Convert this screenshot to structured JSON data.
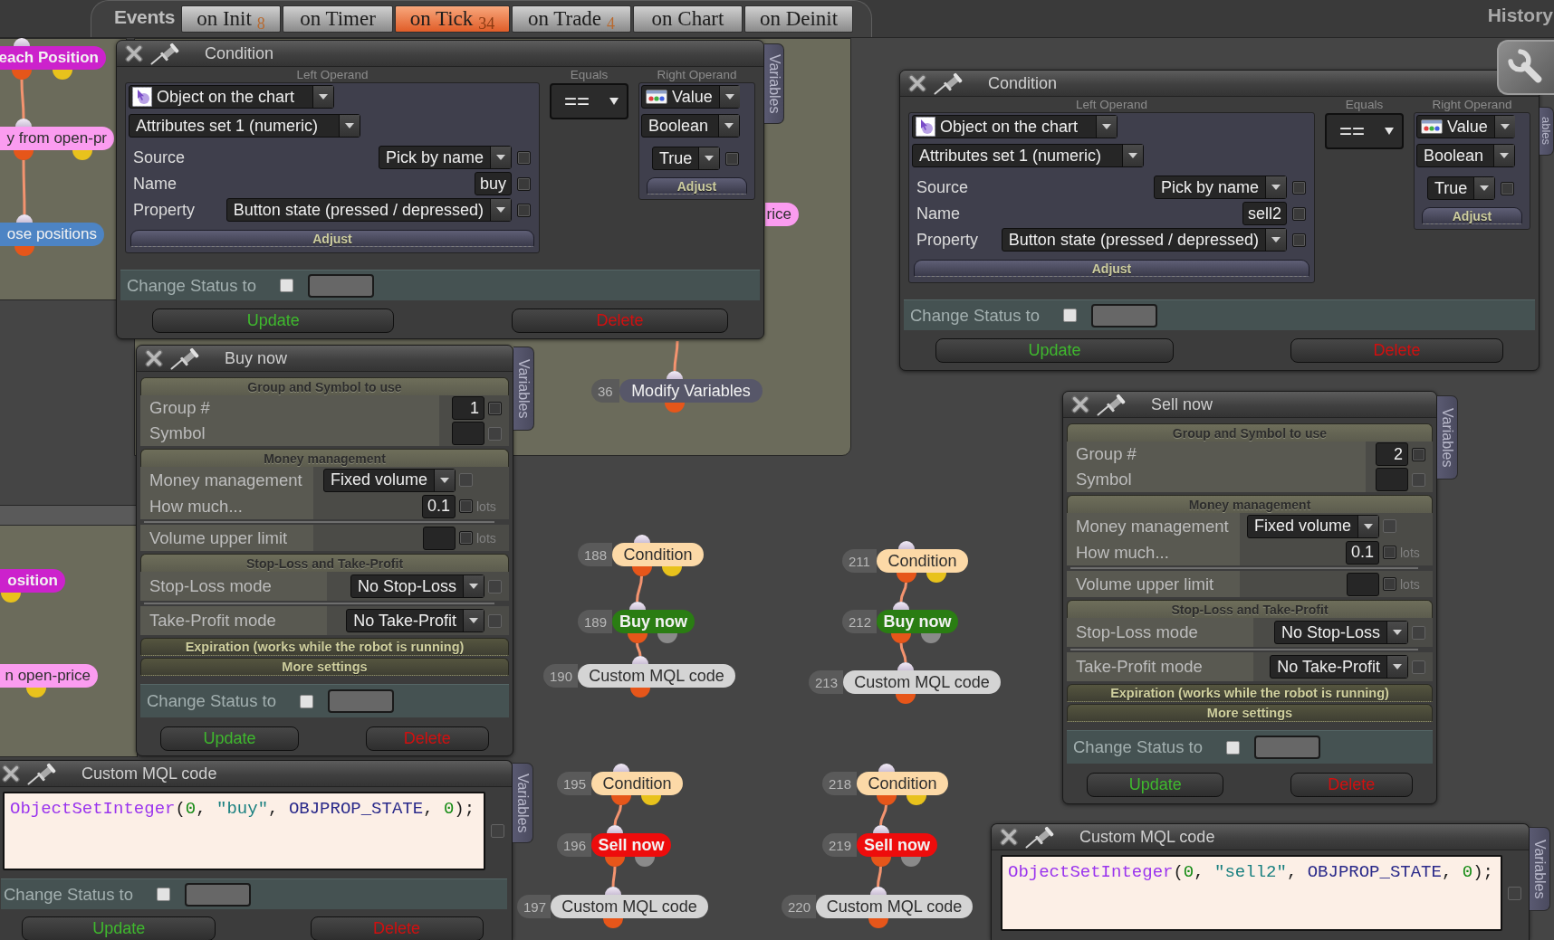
{
  "toolbar": {
    "label": "Events",
    "tabs": [
      {
        "label": "on Init",
        "count": "8",
        "selected": false
      },
      {
        "label": "on Timer",
        "selected": false
      },
      {
        "label": "on Tick",
        "count": "34",
        "selected": true
      },
      {
        "label": "on Trade",
        "count": "4",
        "selected": false
      },
      {
        "label": "on Chart",
        "selected": false
      },
      {
        "label": "on Deinit",
        "selected": false
      }
    ],
    "history": "History"
  },
  "nodes": [
    {
      "label": "each Position",
      "kind": "loop",
      "color": "#cc22cc",
      "connected": false
    },
    {
      "label": "y from open-pr",
      "kind": "filter",
      "color": "#fb9cf0",
      "connected": true
    },
    {
      "label": "ose positions",
      "kind": "close",
      "color": "#4d84c4",
      "connected": true
    },
    {
      "label": "osition",
      "kind": "loop",
      "color": "#cc22cc",
      "connected": false
    },
    {
      "label": "n open-price",
      "kind": "filter",
      "color": "#fb9cf0",
      "connected": false
    },
    {
      "label": "rice",
      "kind": "filter",
      "color": "#fb9cf0",
      "connected": false
    },
    {
      "number": "36",
      "label": "Modify Variables",
      "kind": "variables",
      "color": "#575769",
      "connected": true
    },
    {
      "number": "188",
      "label": "Condition",
      "kind": "condition",
      "color": "#fcd9a7",
      "connected": false
    },
    {
      "number": "189",
      "label": "Buy now",
      "kind": "trade",
      "color": "#2a7d13",
      "connected": true
    },
    {
      "number": "190",
      "label": "Custom MQL code",
      "kind": "code",
      "color": "#d4d4d4",
      "connected": true
    },
    {
      "number": "211",
      "label": "Condition",
      "kind": "condition",
      "color": "#fcd9a7",
      "connected": false
    },
    {
      "number": "212",
      "label": "Buy now",
      "kind": "trade",
      "color": "#2a7d13",
      "connected": true
    },
    {
      "number": "213",
      "label": "Custom MQL code",
      "kind": "code",
      "color": "#d4d4d4",
      "connected": true
    },
    {
      "number": "195",
      "label": "Condition",
      "kind": "condition",
      "color": "#fcd9a7",
      "connected": false
    },
    {
      "number": "196",
      "label": "Sell now",
      "kind": "trade",
      "color": "#ee0c0c",
      "connected": true
    },
    {
      "number": "197",
      "label": "Custom MQL code",
      "kind": "code",
      "color": "#d4d4d4",
      "connected": true
    },
    {
      "number": "218",
      "label": "Condition",
      "kind": "condition",
      "color": "#fcd9a7",
      "connected": false
    },
    {
      "number": "219",
      "label": "Sell now",
      "kind": "trade",
      "color": "#ee0c0c",
      "connected": true
    },
    {
      "number": "220",
      "label": "Custom MQL code",
      "kind": "code",
      "color": "#d4d4d4",
      "connected": true
    }
  ],
  "condition_panels": [
    {
      "title": "Condition",
      "side_tab": "Variables",
      "left_operand": {
        "heading": "Left Operand",
        "type": "Object on the chart",
        "attributes": "Attributes set 1 (numeric)",
        "fields": [
          {
            "label": "Source",
            "kind": "dropdown",
            "value": "Pick by name",
            "checked": false
          },
          {
            "label": "Name",
            "kind": "input",
            "value": "buy",
            "checked": false
          },
          {
            "label": "Property",
            "kind": "dropdown",
            "value": "Button state (pressed / depressed)",
            "checked": false
          }
        ],
        "adjust": "Adjust"
      },
      "operator": {
        "heading": "Equals",
        "value": "=="
      },
      "right_operand": {
        "heading": "Right Operand",
        "type": "Value",
        "data_type": "Boolean",
        "value": "True",
        "checked": false,
        "adjust": "Adjust"
      },
      "status": {
        "label": "Change Status to",
        "checked": false
      },
      "buttons": {
        "update": "Update",
        "delete": "Delete"
      }
    },
    {
      "title": "Condition",
      "side_tab": "ables",
      "left_operand": {
        "heading": "Left Operand",
        "type": "Object on the chart",
        "attributes": "Attributes set 1 (numeric)",
        "fields": [
          {
            "label": "Source",
            "kind": "dropdown",
            "value": "Pick by name",
            "checked": false
          },
          {
            "label": "Name",
            "kind": "input",
            "value": "sell2",
            "checked": false
          },
          {
            "label": "Property",
            "kind": "dropdown",
            "value": "Button state (pressed / depressed)",
            "checked": false
          }
        ],
        "adjust": "Adjust"
      },
      "operator": {
        "heading": "Equals",
        "value": "=="
      },
      "right_operand": {
        "heading": "Right Operand",
        "type": "Value",
        "data_type": "Boolean",
        "value": "True",
        "checked": false,
        "adjust": "Adjust"
      },
      "status": {
        "label": "Change Status to",
        "checked": false
      },
      "buttons": {
        "update": "Update",
        "delete": "Delete"
      }
    }
  ],
  "order_panels": [
    {
      "title": "Buy now",
      "side_tab": "Variables",
      "sections": [
        {
          "heading": "Group and Symbol to use",
          "expanded": true,
          "rows": [
            {
              "label": "Group #",
              "kind": "input",
              "value": "1",
              "checked": false,
              "disabled": false,
              "separated": false
            },
            {
              "label": "Symbol",
              "kind": "input",
              "checked": false,
              "disabled": true,
              "separated": false
            }
          ]
        },
        {
          "heading": "Money management",
          "expanded": true,
          "rows": [
            {
              "label": "Money management",
              "kind": "dropdown",
              "value": "Fixed volume",
              "checked": false,
              "disabled": true,
              "separated": false
            },
            {
              "label": "How much...",
              "kind": "input",
              "value": "0.1",
              "unit": "lots",
              "checked": false,
              "disabled": false,
              "separated": false
            },
            {
              "label": "Volume upper limit",
              "kind": "input",
              "unit": "lots",
              "checked": false,
              "disabled": false,
              "separated": true
            }
          ]
        },
        {
          "heading": "Stop-Loss and Take-Profit",
          "expanded": true,
          "rows": [
            {
              "label": "Stop-Loss mode",
              "kind": "dropdown",
              "value": "No Stop-Loss",
              "checked": false,
              "disabled": true,
              "separated": false
            },
            {
              "label": "Take-Profit mode",
              "kind": "dropdown",
              "value": "No Take-Profit",
              "checked": false,
              "disabled": true,
              "separated": true
            }
          ]
        },
        {
          "heading": "Expiration (works while the robot is running)",
          "expanded": false
        },
        {
          "heading": "More settings",
          "expanded": false
        }
      ],
      "status": {
        "label": "Change Status to",
        "checked": false
      },
      "buttons": {
        "update": "Update",
        "delete": "Delete"
      }
    },
    {
      "title": "Sell now",
      "side_tab": "Variables",
      "sections": [
        {
          "heading": "Group and Symbol to use",
          "expanded": true,
          "rows": [
            {
              "label": "Group #",
              "kind": "input",
              "value": "2",
              "checked": false,
              "disabled": false,
              "separated": false
            },
            {
              "label": "Symbol",
              "kind": "input",
              "checked": false,
              "disabled": true,
              "separated": false
            }
          ]
        },
        {
          "heading": "Money management",
          "expanded": true,
          "rows": [
            {
              "label": "Money management",
              "kind": "dropdown",
              "value": "Fixed volume",
              "checked": false,
              "disabled": true,
              "separated": false
            },
            {
              "label": "How much...",
              "kind": "input",
              "value": "0.1",
              "unit": "lots",
              "checked": false,
              "disabled": false,
              "separated": false
            },
            {
              "label": "Volume upper limit",
              "kind": "input",
              "unit": "lots",
              "checked": false,
              "disabled": false,
              "separated": true
            }
          ]
        },
        {
          "heading": "Stop-Loss and Take-Profit",
          "expanded": true,
          "rows": [
            {
              "label": "Stop-Loss mode",
              "kind": "dropdown",
              "value": "No Stop-Loss",
              "checked": false,
              "disabled": true,
              "separated": false
            },
            {
              "label": "Take-Profit mode",
              "kind": "dropdown",
              "value": "No Take-Profit",
              "checked": false,
              "disabled": true,
              "separated": true
            }
          ]
        },
        {
          "heading": "Expiration (works while the robot is running)",
          "expanded": false
        },
        {
          "heading": "More settings",
          "expanded": false
        }
      ],
      "status": {
        "label": "Change Status to",
        "checked": false
      },
      "buttons": {
        "update": "Update",
        "delete": "Delete"
      }
    }
  ],
  "code_panels": [
    {
      "title": "Custom MQL code",
      "side_tab": "Variables",
      "code": [
        {
          "text": "ObjectSetInteger",
          "kind": "function"
        },
        {
          "text": "(",
          "kind": "punct"
        },
        {
          "text": "0",
          "kind": "number"
        },
        {
          "text": ", ",
          "kind": "punct"
        },
        {
          "text": "\"buy\"",
          "kind": "string"
        },
        {
          "text": ", ",
          "kind": "punct"
        },
        {
          "text": "OBJPROP_STATE",
          "kind": "constant"
        },
        {
          "text": ", ",
          "kind": "punct"
        },
        {
          "text": "0",
          "kind": "number"
        },
        {
          "text": ");",
          "kind": "punct"
        }
      ],
      "checked": false,
      "disabled": true,
      "status": {
        "label": "Change Status to",
        "checked": false
      },
      "buttons": {
        "update": "Update",
        "delete": "Delete"
      }
    },
    {
      "title": "Custom MQL code",
      "side_tab": "Variables",
      "code": [
        {
          "text": "ObjectSetInteger",
          "kind": "function"
        },
        {
          "text": "(",
          "kind": "punct"
        },
        {
          "text": "0",
          "kind": "number"
        },
        {
          "text": ", ",
          "kind": "punct"
        },
        {
          "text": "\"sell2\"",
          "kind": "string"
        },
        {
          "text": ", ",
          "kind": "punct"
        },
        {
          "text": "OBJPROP_STATE",
          "kind": "constant"
        },
        {
          "text": ", ",
          "kind": "punct"
        },
        {
          "text": "0",
          "kind": "number"
        },
        {
          "text": ");",
          "kind": "punct"
        }
      ],
      "checked": false,
      "disabled": true
    }
  ]
}
